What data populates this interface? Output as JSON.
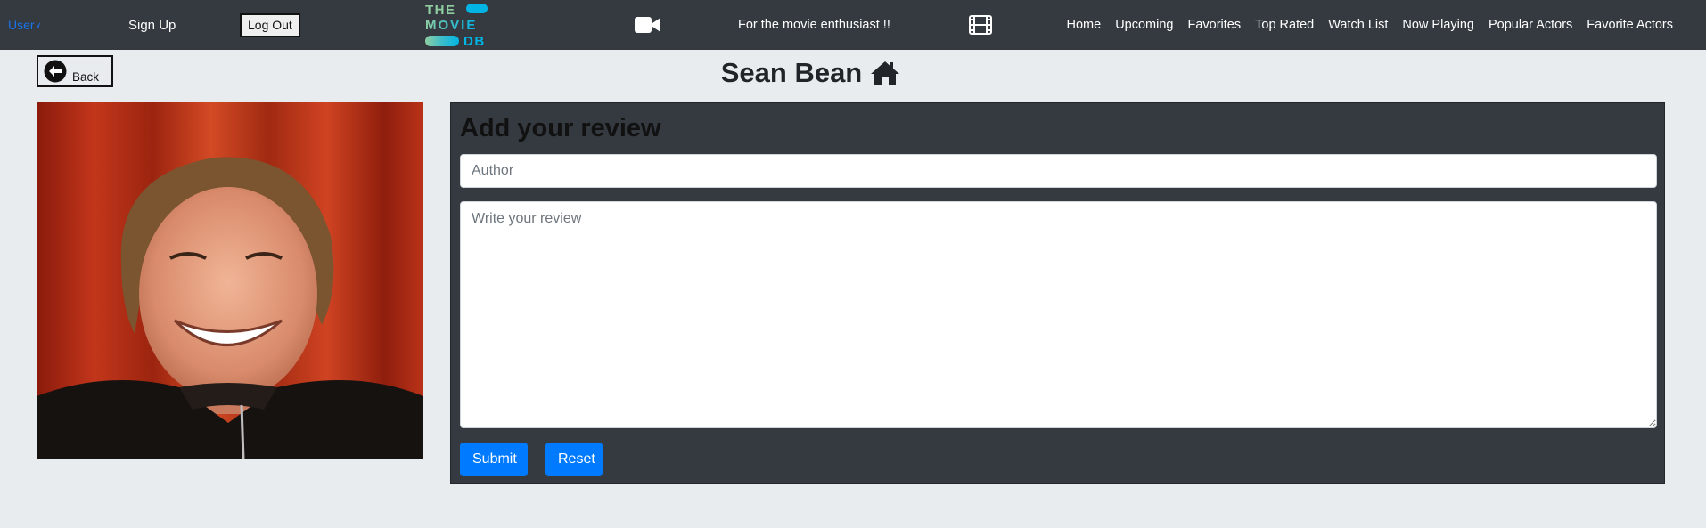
{
  "navbar": {
    "user_menu_label": "User",
    "signup_label": "Sign Up",
    "logout_label": "Log Out",
    "logo": {
      "line1": "THE",
      "line2": "MOVIE",
      "line3": "DB",
      "colors": {
        "teal": "#1fd1a2",
        "blue": "#01b4e4"
      }
    },
    "camera_icon": "video-camera-icon",
    "tagline": "For the movie enthusiast !!",
    "film_icon": "film-icon",
    "menu": [
      "Home",
      "Upcoming",
      "Favorites",
      "Top Rated",
      "Watch List",
      "Now Playing",
      "Popular Actors",
      "Favorite Actors"
    ]
  },
  "back_button": {
    "label": "Back",
    "icon": "arrow-circle-left-icon"
  },
  "page": {
    "title": "Sean Bean",
    "title_icon": "home-icon"
  },
  "actor": {
    "photo_icon": "actor-portrait"
  },
  "review": {
    "heading": "Add your review",
    "author_placeholder": "Author",
    "author_value": "",
    "review_placeholder": "Write your review",
    "review_value": "",
    "submit_label": "Submit",
    "reset_label": "Reset"
  },
  "colors": {
    "navbar_bg": "#343a40",
    "page_bg": "#e9ecef",
    "primary": "#007bff",
    "user_link": "#1a73e8"
  }
}
